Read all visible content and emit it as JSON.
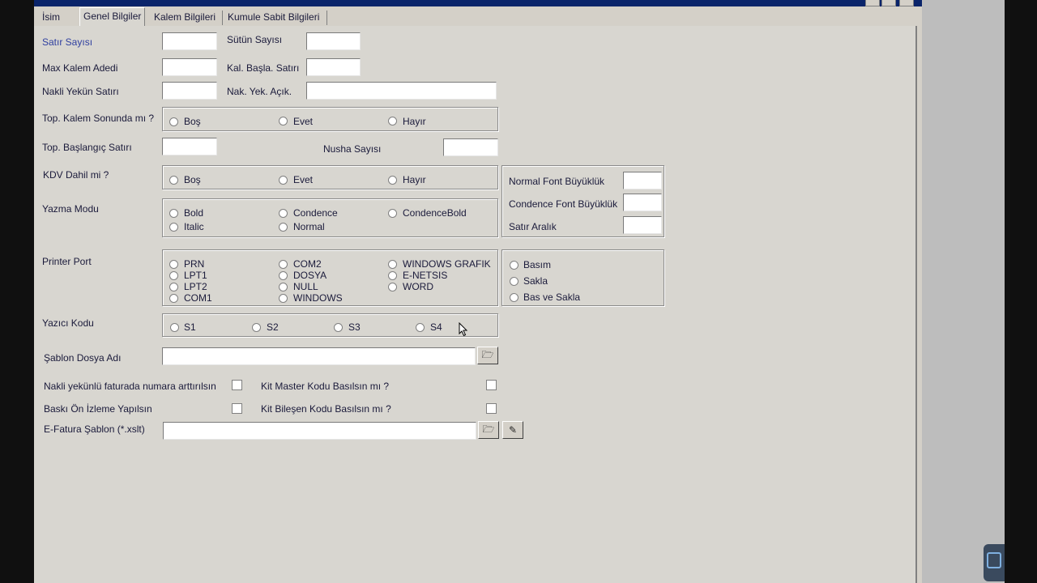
{
  "tabs": {
    "isim": "İsim",
    "genel": "Genel Bilgiler",
    "kalem": "Kalem Bilgileri",
    "kumule": "Kumule Sabit Bilgileri"
  },
  "form": {
    "satir_sayisi": "Satır Sayısı",
    "sutun_sayisi": "Sütün Sayısı",
    "max_kalem": "Max Kalem Adedi",
    "kal_basla": "Kal. Başla. Satırı",
    "nakli_yekun": "Nakli Yekün Satırı",
    "nak_yek_acik": "Nak. Yek. Açık.",
    "top_kalem_sonunda": "Top. Kalem Sonunda mı ?",
    "top_baslangic": "Top. Başlangıç Satırı",
    "nusha_sayisi": "Nusha Sayısı",
    "kdv_dahil": "KDV Dahil mi ?",
    "yazma_modu": "Yazma Modu",
    "printer_port": "Printer Port",
    "yazici_kodu": "Yazıcı Kodu",
    "sablon_dosya": "Şablon Dosya Adı",
    "nakli_yekunlu": "Nakli yekünlü faturada numara arttırılsın",
    "kit_master": "Kit Master Kodu Basılsın mı ?",
    "baski_on_izleme": "Baskı Ön İzleme Yapılsın",
    "kit_bilesen": "Kit Bileşen Kodu Basılsın mı ?",
    "efatura_sablon": "E-Fatura Şablon (*.xslt)"
  },
  "radios": {
    "bos": "Boş",
    "evet": "Evet",
    "hayir": "Hayır",
    "bold": "Bold",
    "condence": "Condence",
    "condencebold": "CondenceBold",
    "italic": "Italic",
    "normal": "Normal",
    "prn": "PRN",
    "lpt1": "LPT1",
    "lpt2": "LPT2",
    "com1": "COM1",
    "com2": "COM2",
    "dosya": "DOSYA",
    "null": "NULL",
    "windows": "WINDOWS",
    "windows_grafik": "WINDOWS GRAFIK",
    "enetsis": "E-NETSIS",
    "word": "WORD",
    "basim": "Basım",
    "sakla": "Sakla",
    "bas_ve_sakla": "Bas ve Sakla",
    "s1": "S1",
    "s2": "S2",
    "s3": "S3",
    "s4": "S4"
  },
  "font_panel": {
    "normal_font": "Normal Font Büyüklük",
    "condence_font": "Condence Font Büyüklük",
    "satir_aralik": "Satır Aralık"
  },
  "icons": {
    "browse": "folder-open-icon",
    "edit": "edit-icon"
  }
}
